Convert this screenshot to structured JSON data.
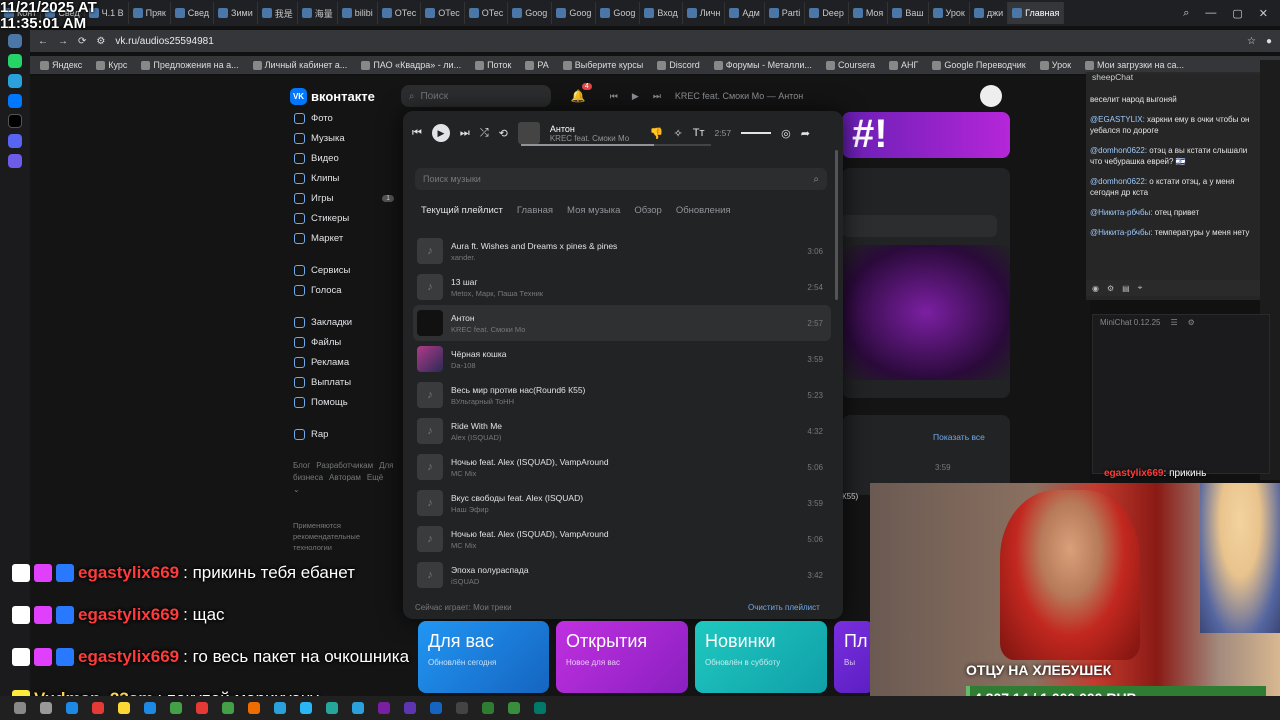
{
  "overlay": {
    "date_line": "11/21/2025 AT",
    "time_line": "11:35:01 AM"
  },
  "browser": {
    "tabs": [
      "Конт",
      "Свед",
      "Ч.1 В",
      "Пряк",
      "Свед",
      "Зими",
      "我是",
      "海量",
      "bilibi",
      "ОТес",
      "ОТес",
      "ОТес",
      "Goog",
      "Goog",
      "Goog",
      "Вход",
      "Личн",
      "Адм",
      "Parti",
      "Deep",
      "Моя",
      "Ваш",
      "Урок",
      "джи",
      "Главная"
    ],
    "active_tab": "Главная",
    "url": "vk.ru/audios25594981",
    "bookmarks": [
      "Яндекс",
      "Курс",
      "Предложения на а...",
      "Личный кабинет а...",
      "ПАО «Квадра» - ли...",
      "Поток",
      "РА",
      "Выберите курсы",
      "Discord",
      "Форумы - Металли...",
      "Coursera",
      "АНГ",
      "Google Переводчик",
      "Урок",
      "Мои загрузки на са..."
    ]
  },
  "vk": {
    "logo_text": "вконтакте",
    "search_placeholder": "Поиск",
    "notif_count": "4",
    "header_now_playing": "KREC feat. Смоки Мо — Антон",
    "nav": [
      {
        "label": "Фото"
      },
      {
        "label": "Музыка"
      },
      {
        "label": "Видео"
      },
      {
        "label": "Клипы"
      },
      {
        "label": "Игры",
        "count": "1"
      },
      {
        "label": "Стикеры"
      },
      {
        "label": "Маркет"
      }
    ],
    "nav2": [
      {
        "label": "Сервисы"
      },
      {
        "label": "Голоса"
      }
    ],
    "nav3": [
      {
        "label": "Закладки"
      },
      {
        "label": "Файлы"
      },
      {
        "label": "Реклама"
      },
      {
        "label": "Выплаты"
      },
      {
        "label": "Помощь"
      }
    ],
    "nav4": [
      {
        "label": "Rap"
      }
    ],
    "footer_links": [
      "Блог",
      "Разработчикам",
      "Для бизнеса",
      "Авторам",
      "Ещё ⌄"
    ],
    "applied_text": "Применяются рекомендательные технологии",
    "show_all": "Показать все",
    "side_time": "3:59",
    "side_k55": "К55)"
  },
  "player": {
    "current_title": "Антон",
    "current_artist": "KREC feat. Смоки Мо",
    "current_time": "2:57",
    "progress_fraction": 0.7,
    "search_placeholder": "Поиск музыки",
    "tabs": [
      "Текущий плейлист",
      "Главная",
      "Моя музыка",
      "Обзор",
      "Обновления"
    ],
    "active_tab": "Текущий плейлист",
    "tracks": [
      {
        "title": "Aura ft. Wishes and Dreams x pines & pines",
        "artist": "xander.",
        "dur": "3:06"
      },
      {
        "title": "13 шаг",
        "artist": "Metox, Марк, Паша Техник",
        "dur": "2:54"
      },
      {
        "title": "Антон",
        "artist": "KREC feat. Смоки Мо",
        "dur": "2:57",
        "current": true
      },
      {
        "title": "Чёрная кошка",
        "artist": "Da-108",
        "dur": "3:59"
      },
      {
        "title": "Весь мир против нас(Round6 К55)",
        "artist": "ВУльгарный ТоНН",
        "dur": "5:23"
      },
      {
        "title": "Ride With Me",
        "artist": "Alex (ISQUAD)",
        "dur": "4:32"
      },
      {
        "title": "Ночью feat. Alex (ISQUAD), VampAround",
        "artist": "MC Mix",
        "dur": "5:06"
      },
      {
        "title": "Вкус свободы feat. Alex (ISQUAD)",
        "artist": "Наш Эфир",
        "dur": "3:59"
      },
      {
        "title": "Ночью feat. Alex (ISQUAD), VampAround",
        "artist": "MC Mix",
        "dur": "5:06"
      },
      {
        "title": "Эпоха полураспада",
        "artist": "iSQUAD",
        "dur": "3:42"
      }
    ],
    "now_playing_label": "Сейчас играет: Мои треки",
    "clear_label": "Очистить плейлист"
  },
  "tiles": [
    {
      "title": "Для вас",
      "sub": "Обновлён сегодня"
    },
    {
      "title": "Открытия",
      "sub": "Новое для вас"
    },
    {
      "title": "Новинки",
      "sub": "Обновлён в субботу"
    },
    {
      "title": "Пл",
      "sub": "Вы"
    }
  ],
  "sheepchat": {
    "title": "sheepChat",
    "messages": [
      {
        "name": "",
        "text": "веселит народ выгоняй"
      },
      {
        "name": "@EGASTYLIX:",
        "text": "харкни ему в очки чтобы он уебался по дороге"
      },
      {
        "name": "@domhon0622:",
        "text": "отэц а вы кстати слышали что чебурашка еврей? 🇮🇱"
      },
      {
        "name": "@domhon0622:",
        "text": "о кстати отэц, а у меня сегодня др кста"
      },
      {
        "name": "@Никита-рбчбы:",
        "text": "отец привет"
      },
      {
        "name": "@Никита-рбчбы:",
        "text": "температуры у меня нету"
      }
    ],
    "minichat_title": "MiniChat 0.12.25",
    "side_msg_user": "egastylix669",
    "side_msg_text": "прикинь"
  },
  "stream_chat": [
    {
      "user": "egastylix669",
      "text": ": прикинь тебя ебанет"
    },
    {
      "user": "egastylix669",
      "text": ": щас"
    },
    {
      "user": "egastylix669",
      "text": ": го весь пакет на очкошника"
    },
    {
      "user": "Vudman_23sm",
      "text": ": покупай марихуану"
    }
  ],
  "webcam": {
    "label": "ОТЦУ НА ХЛЕБУШЕК",
    "goal": "4 807.14 / 1 000 000 RUB"
  }
}
